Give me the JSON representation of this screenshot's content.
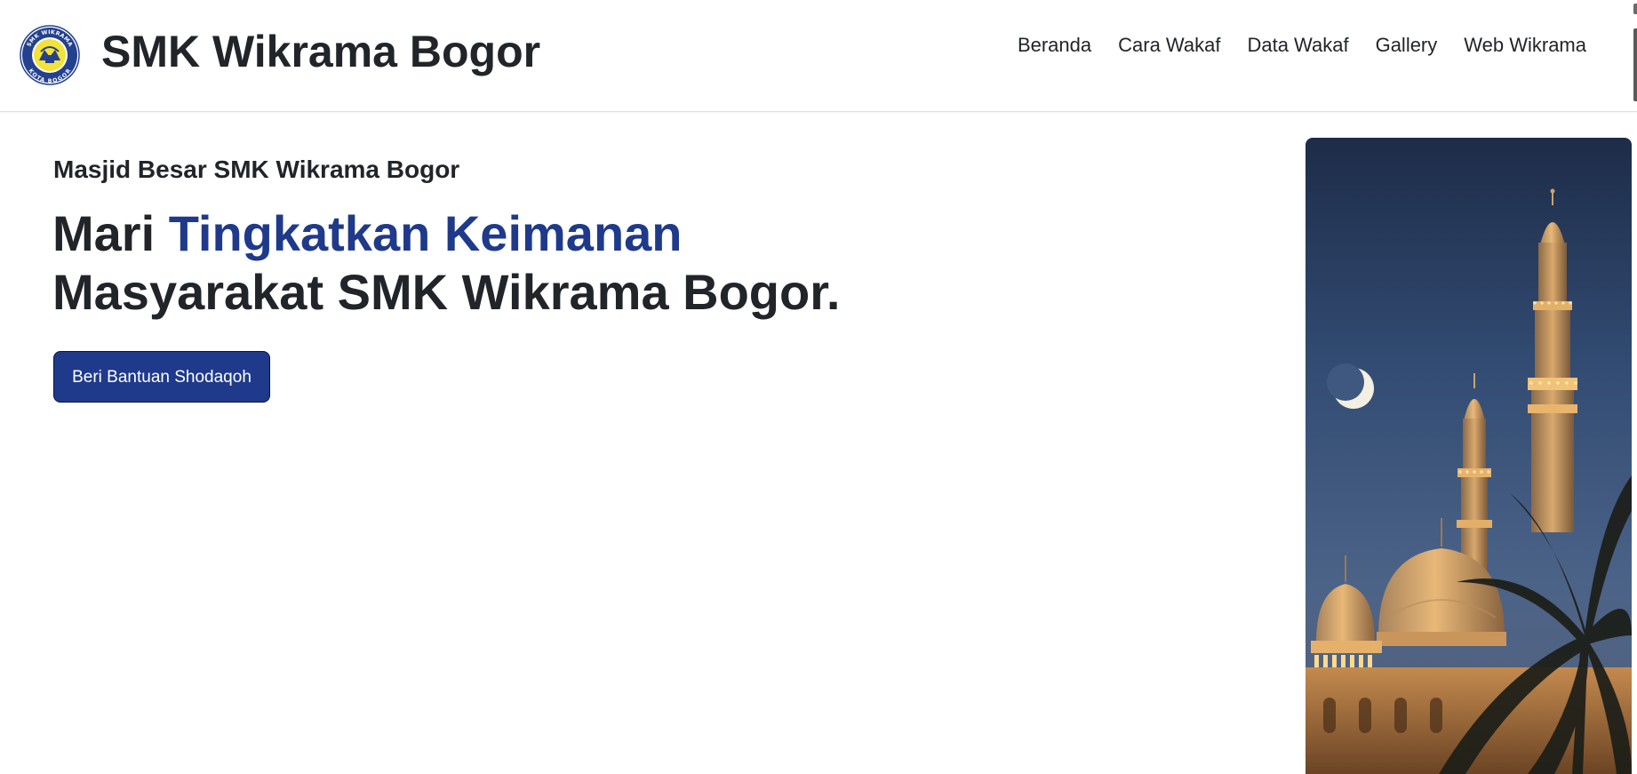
{
  "header": {
    "brand_title": "SMK Wikrama Bogor",
    "logo_ring_text_top": "SMK WIKRAMA",
    "logo_ring_text_bottom": "KOTA BOGOR",
    "nav_items": [
      {
        "label": "Beranda"
      },
      {
        "label": "Cara Wakaf"
      },
      {
        "label": "Data Wakaf"
      },
      {
        "label": "Gallery"
      },
      {
        "label": "Web Wikrama"
      }
    ]
  },
  "hero": {
    "subtitle": "Masjid Besar SMK Wikrama Bogor",
    "headline_prefix": "Mari ",
    "headline_accent": "Tingkatkan Keimanan",
    "headline_line2": "Masyarakat SMK Wikrama Bogor.",
    "cta_label": "Beri Bantuan Shodaqoh",
    "image_subject": "mosque-at-night-with-crescent-moon"
  },
  "colors": {
    "accent": "#1f3a8a",
    "text": "#212529",
    "logo_blue": "#23418f",
    "logo_yellow": "#f2e23a"
  }
}
